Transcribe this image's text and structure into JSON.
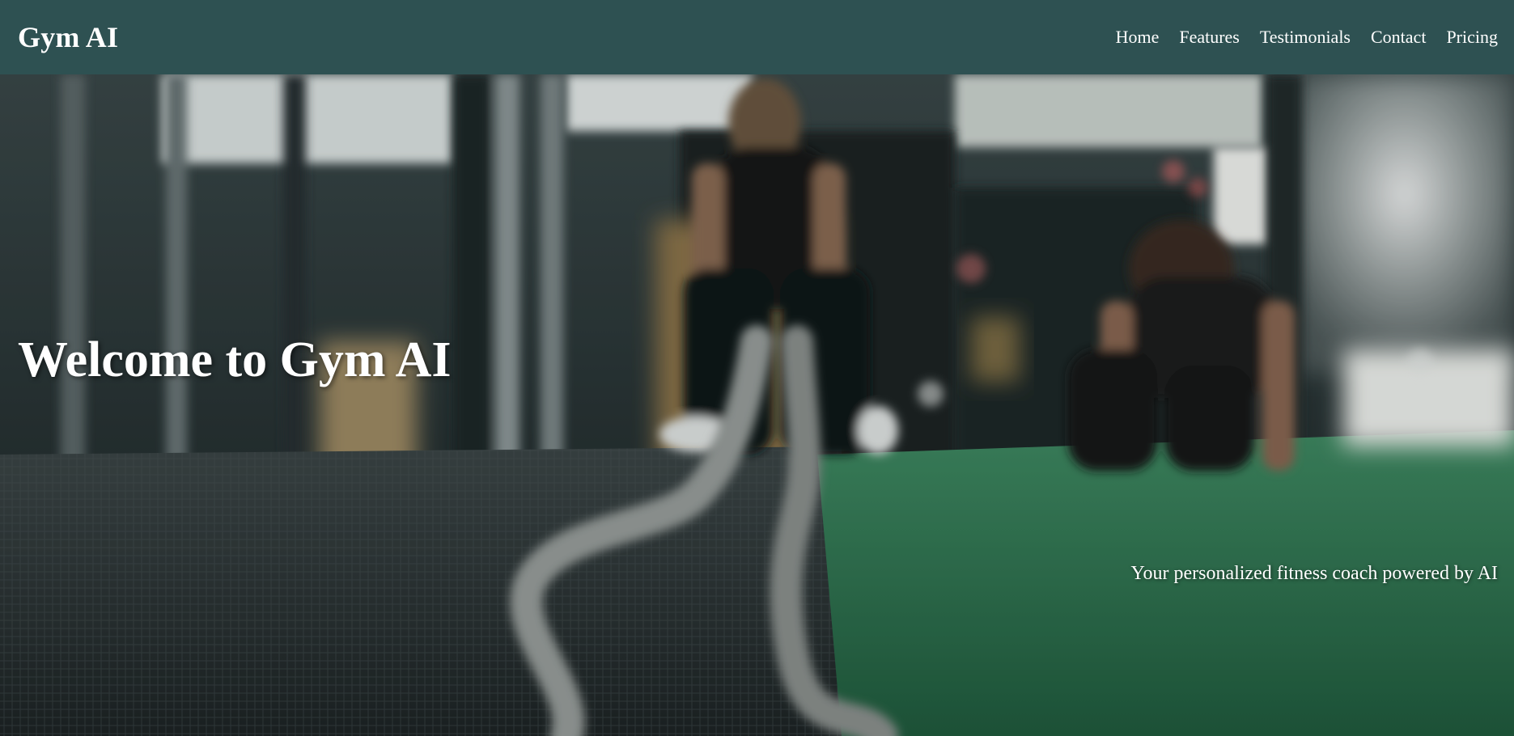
{
  "brand": {
    "name": "Gym AI"
  },
  "nav": {
    "items": [
      {
        "label": "Home"
      },
      {
        "label": "Features"
      },
      {
        "label": "Testimonials"
      },
      {
        "label": "Contact"
      },
      {
        "label": "Pricing"
      }
    ]
  },
  "hero": {
    "title": "Welcome to Gym AI",
    "subtitle": "Your personalized fitness coach powered by AI",
    "background_image": "gym-battle-ropes-photo"
  },
  "colors": {
    "navbar_bg": "#2e5152",
    "text": "#ffffff",
    "turf_green": "#2f7a52"
  }
}
